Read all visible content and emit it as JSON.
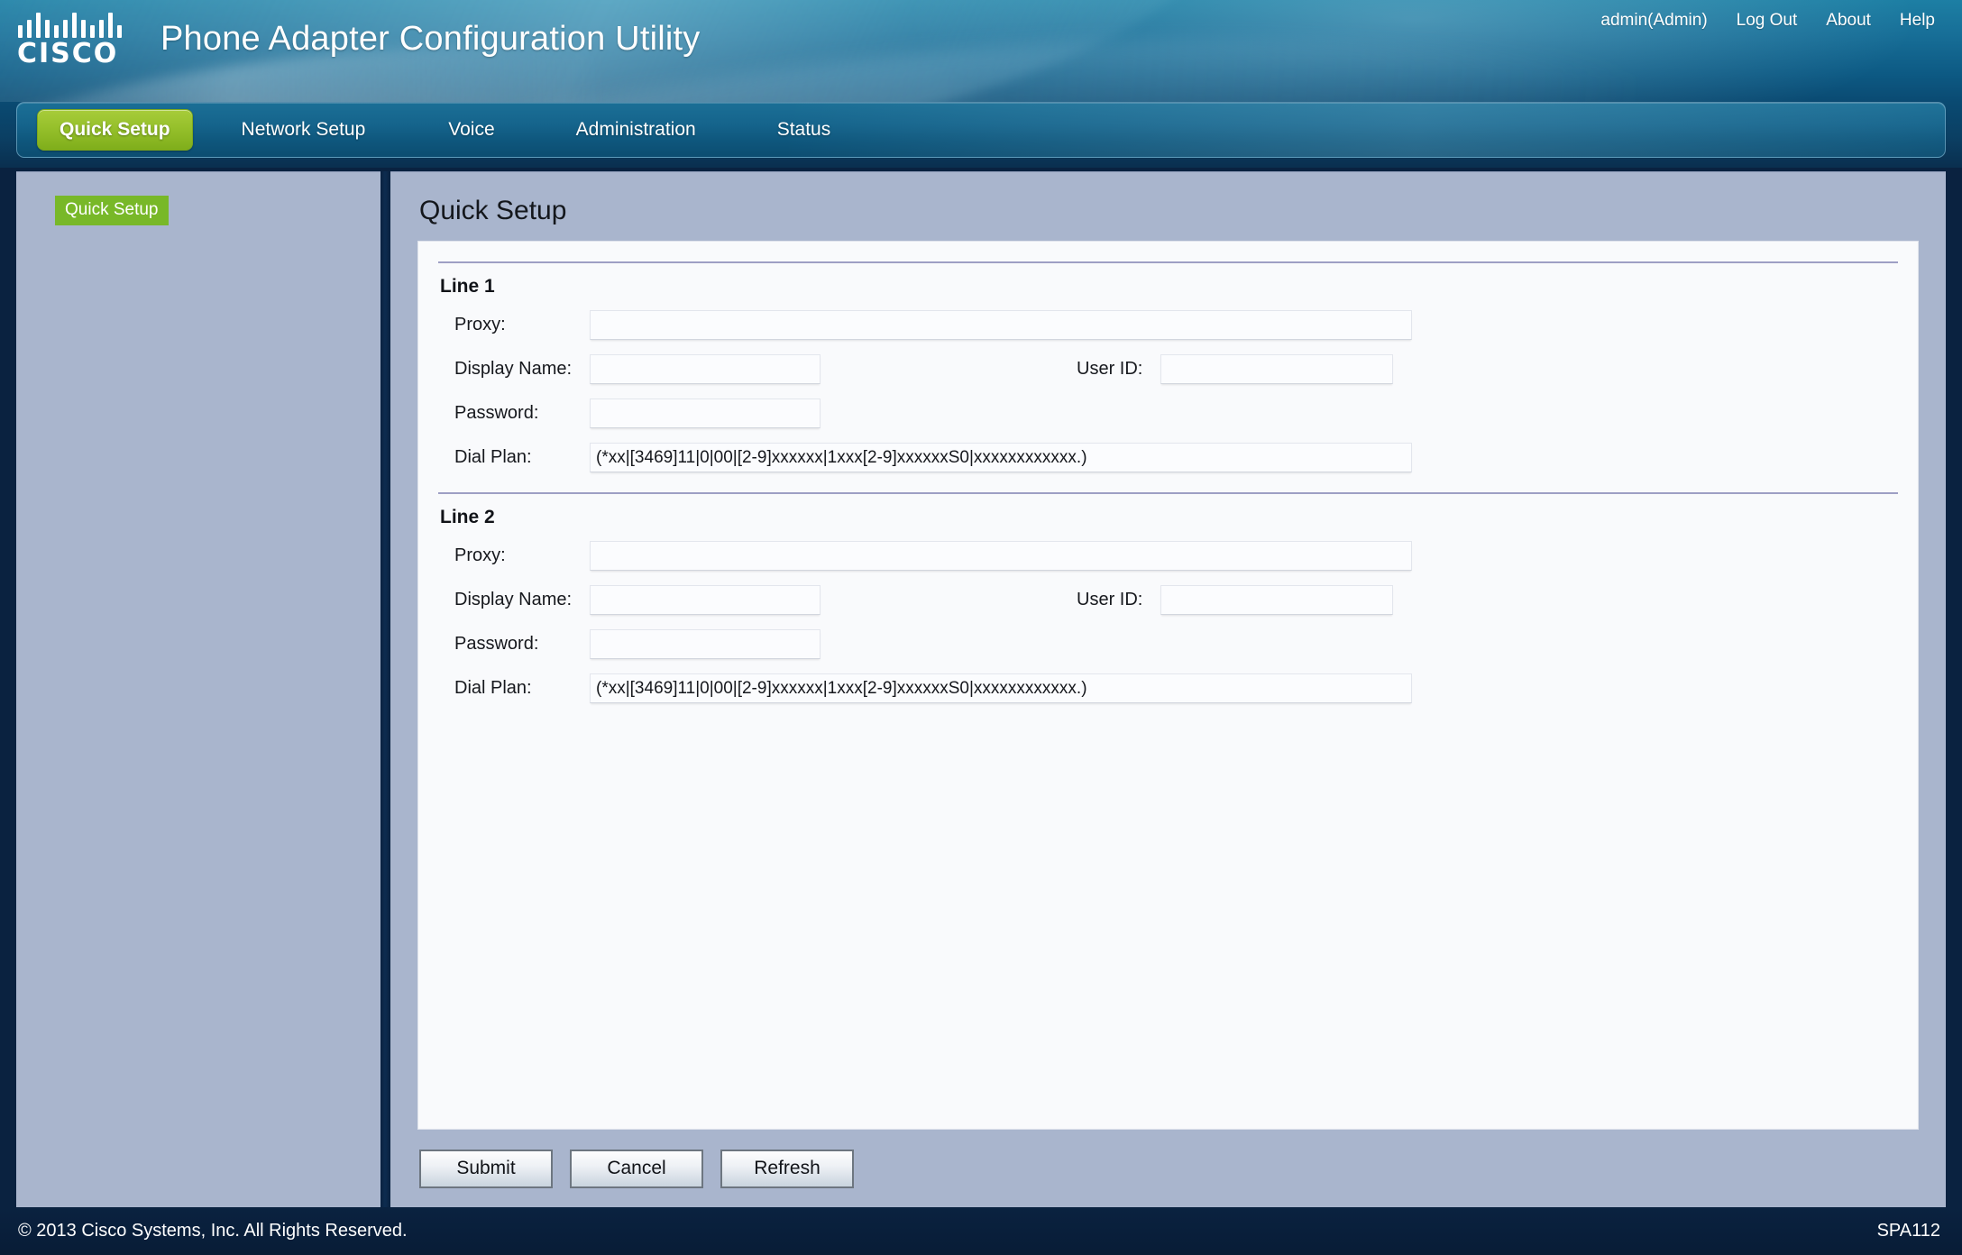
{
  "header": {
    "logo_name": "cisco-logo",
    "logo_word": "CISCO",
    "app_title": "Phone Adapter Configuration Utility",
    "links": [
      {
        "label": "admin(Admin)",
        "name": "user-account-link"
      },
      {
        "label": "Log Out",
        "name": "log-out-link"
      },
      {
        "label": "About",
        "name": "about-link"
      },
      {
        "label": "Help",
        "name": "help-link"
      }
    ]
  },
  "nav": {
    "tabs": [
      {
        "label": "Quick Setup",
        "active": true
      },
      {
        "label": "Network Setup",
        "active": false
      },
      {
        "label": "Voice",
        "active": false
      },
      {
        "label": "Administration",
        "active": false
      },
      {
        "label": "Status",
        "active": false
      }
    ],
    "active_color": "#96c02b"
  },
  "sidebar": {
    "items": [
      {
        "label": "Quick Setup",
        "selected": true
      }
    ]
  },
  "main": {
    "page_title": "Quick Setup",
    "sections": [
      {
        "title": "Line 1",
        "fields": {
          "proxy_label": "Proxy:",
          "proxy_value": "",
          "display_name_label": "Display Name:",
          "display_name_value": "",
          "user_id_label": "User ID:",
          "user_id_value": "",
          "password_label": "Password:",
          "password_value": "",
          "dial_plan_label": "Dial Plan:",
          "dial_plan_value": "(*xx|[3469]11|0|00|[2-9]xxxxxx|1xxx[2-9]xxxxxxS0|xxxxxxxxxxxx.)"
        }
      },
      {
        "title": "Line 2",
        "fields": {
          "proxy_label": "Proxy:",
          "proxy_value": "",
          "display_name_label": "Display Name:",
          "display_name_value": "",
          "user_id_label": "User ID:",
          "user_id_value": "",
          "password_label": "Password:",
          "password_value": "",
          "dial_plan_label": "Dial Plan:",
          "dial_plan_value": "(*xx|[3469]11|0|00|[2-9]xxxxxx|1xxx[2-9]xxxxxxS0|xxxxxxxxxxxx.)"
        }
      }
    ],
    "buttons": {
      "submit": "Submit",
      "cancel": "Cancel",
      "refresh": "Refresh"
    }
  },
  "footer": {
    "copyright": "© 2013 Cisco Systems, Inc. All Rights Reserved.",
    "model": "SPA112"
  }
}
